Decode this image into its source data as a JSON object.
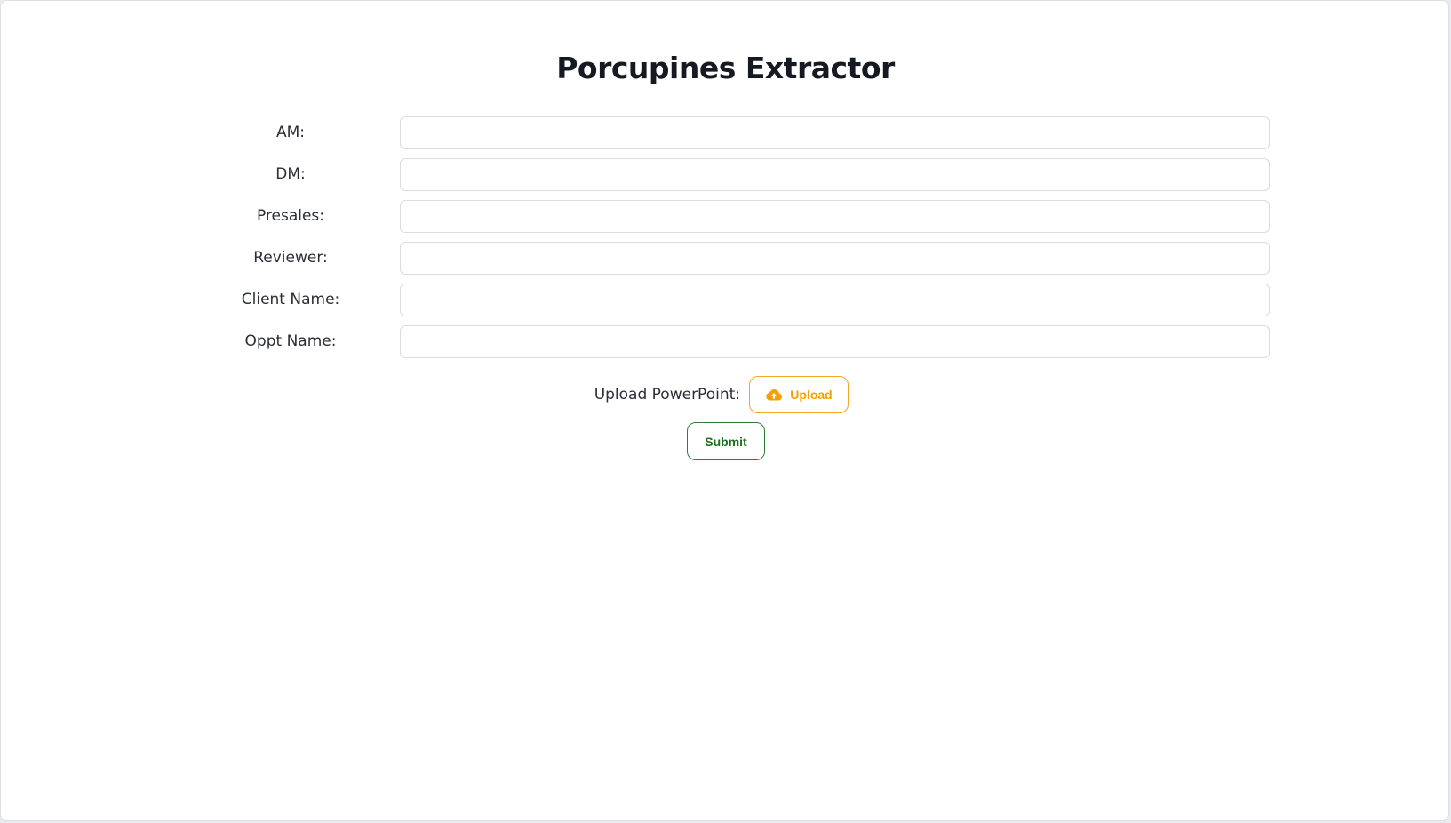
{
  "page": {
    "title": "Porcupines Extractor"
  },
  "form": {
    "fields": [
      {
        "label": "AM:",
        "value": "",
        "placeholder": ""
      },
      {
        "label": "DM:",
        "value": "",
        "placeholder": ""
      },
      {
        "label": "Presales:",
        "value": "",
        "placeholder": ""
      },
      {
        "label": "Reviewer:",
        "value": "",
        "placeholder": ""
      },
      {
        "label": "Client Name:",
        "value": "",
        "placeholder": ""
      },
      {
        "label": "Oppt Name:",
        "value": "",
        "placeholder": ""
      }
    ],
    "upload": {
      "label": "Upload PowerPoint:",
      "button_label": "Upload",
      "icon": "cloud-upload-icon"
    },
    "submit_label": "Submit"
  },
  "colors": {
    "upload_accent": "#f5a623",
    "submit_accent": "#2e7d32",
    "title": "#151a22"
  }
}
